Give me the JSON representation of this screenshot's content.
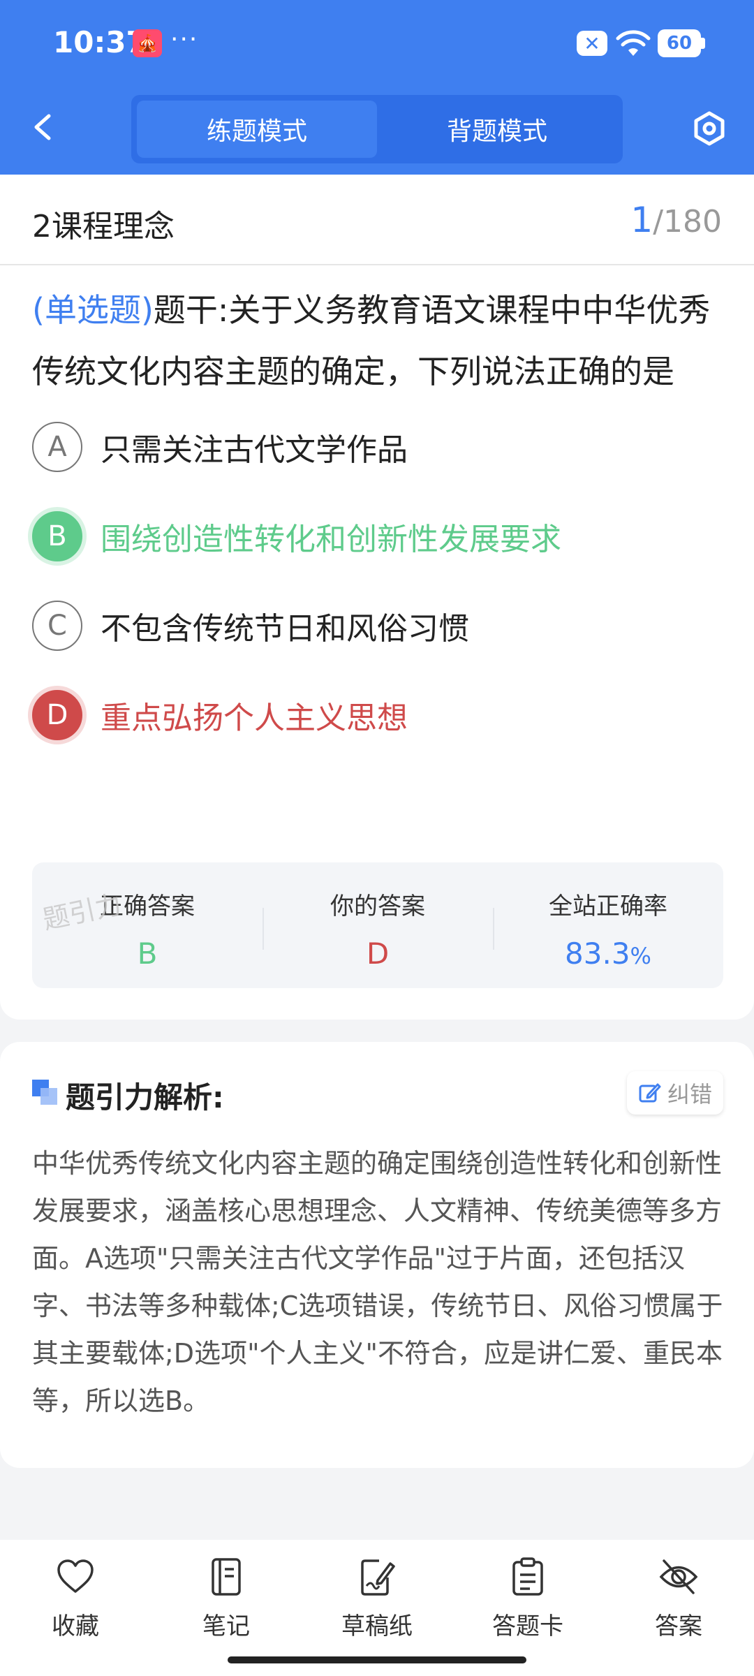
{
  "status_bar": {
    "time": "10:37",
    "app_badge": "🎪",
    "more": "···",
    "battery": "60"
  },
  "header": {
    "modes": [
      "练题模式",
      "背题模式"
    ],
    "active_mode_index": 0
  },
  "section": {
    "title": "2课程理念",
    "current": "1",
    "total": "/180"
  },
  "question": {
    "type_label": "(单选题)",
    "text": "题干:关于义务教育语文课程中中华优秀传统文化内容主题的确定，下列说法正确的是",
    "options": [
      {
        "letter": "A",
        "text": "只需关注古代文学作品",
        "state": "normal"
      },
      {
        "letter": "B",
        "text": "围绕创造性转化和创新性发展要求",
        "state": "correct"
      },
      {
        "letter": "C",
        "text": "不包含传统节日和风俗习惯",
        "state": "normal"
      },
      {
        "letter": "D",
        "text": "重点弘扬个人主义思想",
        "state": "wrong"
      }
    ]
  },
  "stats": {
    "correct_label": "正确答案",
    "correct_value": "B",
    "yours_label": "你的答案",
    "yours_value": "D",
    "rate_label": "全站正确率",
    "rate_value": "83.3",
    "rate_unit": "%",
    "watermark": "题引力"
  },
  "analysis": {
    "title": "题引力解析:",
    "report_label": "纠错",
    "text": "中华优秀传统文化内容主题的确定围绕创造性转化和创新性发展要求，涵盖核心思想理念、人文精神、传统美德等多方面。A选项\"只需关注古代文学作品\"过于片面，还包括汉字、书法等多种载体;C选项错误，传统节日、风俗习惯属于其主要载体;D选项\"个人主义\"不符合，应是讲仁爱、重民本等，所以选B。"
  },
  "bottom_nav": [
    {
      "label": "收藏",
      "icon": "heart-icon"
    },
    {
      "label": "笔记",
      "icon": "notebook-icon"
    },
    {
      "label": "草稿纸",
      "icon": "draft-icon"
    },
    {
      "label": "答题卡",
      "icon": "clipboard-icon"
    },
    {
      "label": "答案",
      "icon": "eye-off-icon"
    }
  ],
  "colors": {
    "primary": "#3f7ff0",
    "correct": "#5ecb8b",
    "wrong": "#cf4a4a"
  }
}
